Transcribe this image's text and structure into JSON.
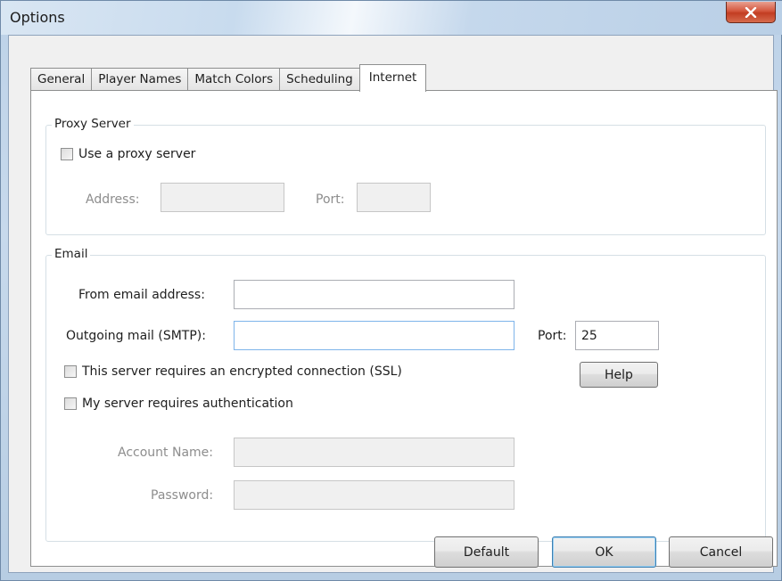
{
  "window": {
    "title": "Options",
    "close_glyph": "x"
  },
  "tabs": [
    {
      "label": "General",
      "active": false
    },
    {
      "label": "Player Names",
      "active": false
    },
    {
      "label": "Match Colors",
      "active": false
    },
    {
      "label": "Scheduling",
      "active": false
    },
    {
      "label": "Internet",
      "active": true
    }
  ],
  "proxy": {
    "title": "Proxy Server",
    "use_proxy_label": "Use a proxy server",
    "use_proxy_checked": false,
    "address_label": "Address:",
    "address_value": "",
    "port_label": "Port:",
    "port_value": ""
  },
  "email": {
    "title": "Email",
    "from_label": "From email address:",
    "from_value": "",
    "smtp_label": "Outgoing mail (SMTP):",
    "smtp_value": "",
    "port_label": "Port:",
    "port_value": "25",
    "ssl_label": "This server requires an encrypted connection (SSL)",
    "ssl_checked": false,
    "help_label": "Help",
    "auth_label": "My server requires authentication",
    "auth_checked": false,
    "account_label": "Account Name:",
    "account_value": "",
    "password_label": "Password:",
    "password_value": ""
  },
  "footer": {
    "default_label": "Default",
    "ok_label": "OK",
    "cancel_label": "Cancel"
  },
  "colors": {
    "close_button": "#c23d22",
    "focus_border": "#7eb4ea"
  }
}
